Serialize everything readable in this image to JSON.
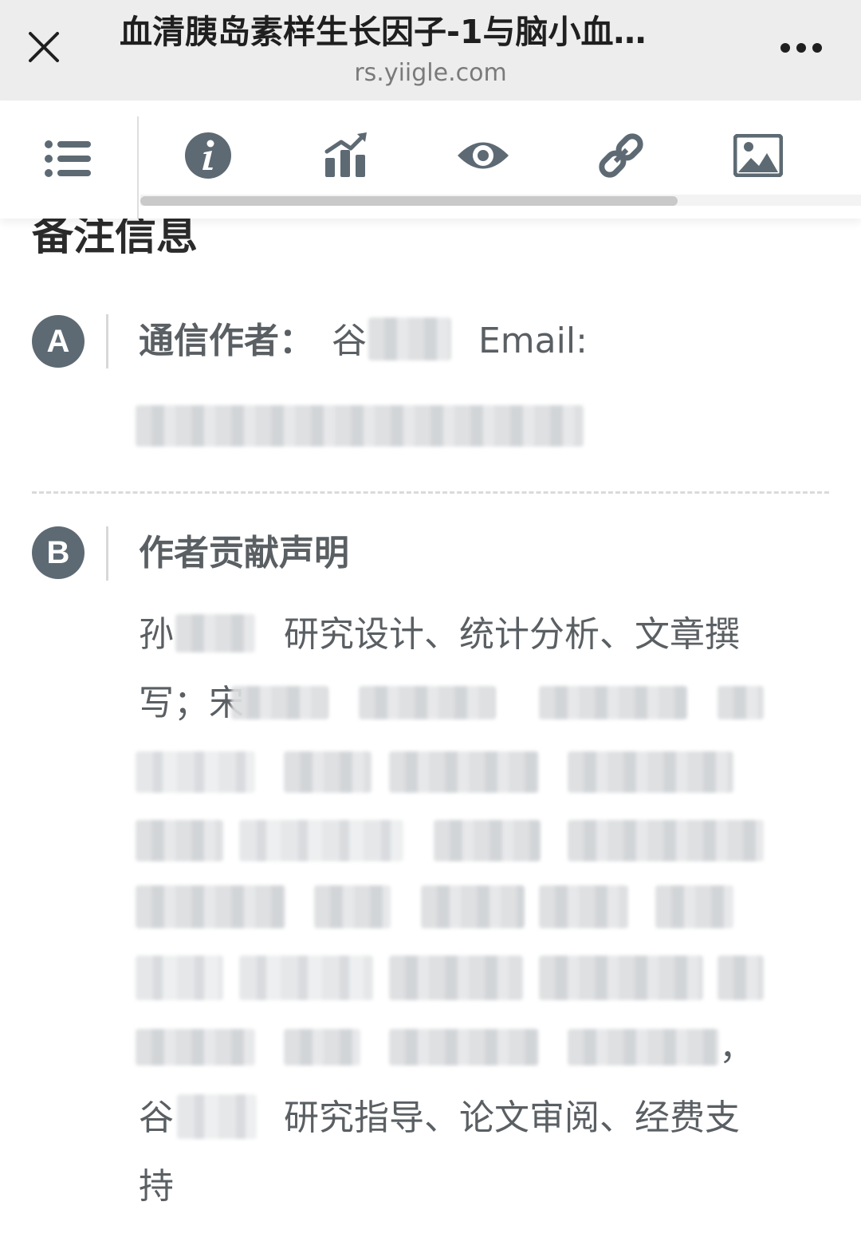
{
  "titlebar": {
    "title": "血清胰岛素样生长因子-1与脑小血…",
    "subtitle": "rs.yiigle.com",
    "close_icon": "close-icon",
    "more_icon": "more-icon"
  },
  "toolbar": {
    "icons": [
      "list-icon",
      "info-icon",
      "chart-icon",
      "eye-icon",
      "link-icon",
      "image-icon"
    ],
    "scroll_progress": 0.75
  },
  "section": {
    "heading": "备注信息"
  },
  "notes": {
    "a": {
      "badge": "A",
      "label": "通信作者：",
      "author_visible": "谷",
      "email_label": "Email:",
      "email_redacted": true
    },
    "b": {
      "badge": "B",
      "label": "作者贡献声明",
      "line1_name": "孙",
      "line1_text": "研究设计、统计分析、文章撰",
      "line2_text": "写；宋",
      "last_name": "谷",
      "last_text": "研究指导、论文审阅、经费支",
      "last_cont": "持",
      "comma": "，"
    }
  },
  "colors": {
    "titlebar_bg": "#ededed",
    "badge_bg": "#5d6a73",
    "icon_color": "#5d6a73",
    "text_color": "#5a5f63"
  }
}
